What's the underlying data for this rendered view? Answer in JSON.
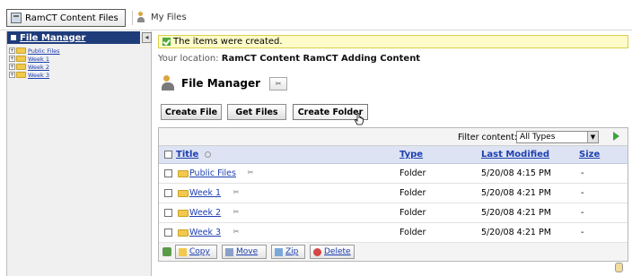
{
  "tabs": {
    "active": "RamCT Content Files",
    "other": "My Files"
  },
  "sidebar": {
    "title": "File Manager",
    "collapse_symbol": "◂",
    "items": [
      {
        "label": "Public Files"
      },
      {
        "label": "Week 1"
      },
      {
        "label": "Week 2"
      },
      {
        "label": "Week 3"
      }
    ]
  },
  "notice": "The items were created.",
  "location": {
    "prefix": "Your location:",
    "path": "RamCT Content RamCT Adding Content"
  },
  "file_manager": {
    "title": "File Manager"
  },
  "toolbar": {
    "create_file": "Create File",
    "get_files": "Get Files",
    "create_folder": "Create Folder"
  },
  "filter": {
    "label": "Filter content:",
    "selected": "All Types"
  },
  "columns": {
    "title": "Title",
    "type": "Type",
    "last_modified": "Last Modified",
    "size": "Size"
  },
  "rows": [
    {
      "name": "Public Files",
      "type": "Folder",
      "modified": "5/20/08 4:15 PM",
      "size": "-"
    },
    {
      "name": "Week 1",
      "type": "Folder",
      "modified": "5/20/08 4:21 PM",
      "size": "-"
    },
    {
      "name": "Week 2",
      "type": "Folder",
      "modified": "5/20/08 4:21 PM",
      "size": "-"
    },
    {
      "name": "Week 3",
      "type": "Folder",
      "modified": "5/20/08 4:21 PM",
      "size": "-"
    }
  ],
  "actions": {
    "copy": "Copy",
    "move": "Move",
    "zip": "Zip",
    "delete": "Delete"
  }
}
